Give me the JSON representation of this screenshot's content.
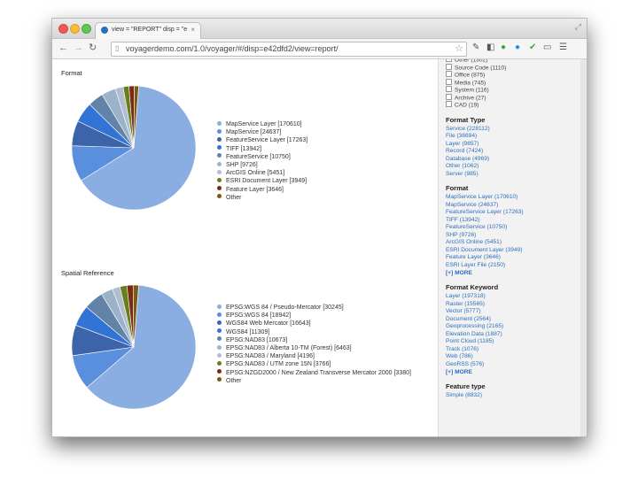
{
  "window": {
    "tab_title": "view = \"REPORT\" disp = \"e",
    "tab_close": "×",
    "url": "voyagerdemo.com/1.0/voyager/#/disp=e42dfd2/view=report/"
  },
  "icons": {
    "back": "back-arrow-icon",
    "forward": "forward-arrow-icon",
    "reload": "reload-icon",
    "star": "bookmark-star-icon"
  },
  "colors": {
    "slices": [
      "#8aaee2",
      "#5a8fdd",
      "#3d64a8",
      "#3273d6",
      "#6382a8",
      "#9cb2c9",
      "#b0bfcf",
      "#6b7e1e",
      "#7a2b12",
      "#7a5a14"
    ],
    "link": "#2a6fbf"
  },
  "format_section": {
    "title": "Format",
    "legend": [
      "MapService Layer [170610]",
      "MapService [24637]",
      "FeatureService Layer [17263]",
      "TIFF [13942]",
      "FeatureService [10750]",
      "SHP [9726]",
      "ArcGIS Online [5451]",
      "ESRI Document Layer [3949]",
      "Feature Layer [3646]",
      "Other"
    ],
    "values": [
      170610,
      24637,
      17263,
      13942,
      10750,
      9726,
      5451,
      3949,
      3646,
      3000
    ]
  },
  "spatial_section": {
    "title": "Spatial Reference",
    "legend": [
      "EPSG:WGS 84 / Pseudo-Mercator [30245]",
      "EPSG:WGS 84 [18942]",
      "WGS84 Web Mercator [16643]",
      "WGS84 [11309]",
      "EPSG:NAD83 [10673]",
      "EPSG:NAD83 / Alberta 10-TM (Forest) [6463]",
      "EPSG:NAD83 / Maryland [4196]",
      "EPSG:NAD83 / UTM zone 15N [3766]",
      "EPSG:NZGD2000 / New Zealand Transverse Mercator 2000 [3380]",
      "Other"
    ],
    "values": [
      130000,
      18942,
      16643,
      11309,
      10673,
      6463,
      4196,
      3766,
      3380,
      3000
    ]
  },
  "sidebar": {
    "top_items": [
      "Other (1302)",
      "Source Code (1110)",
      "Office (875)",
      "Media (745)",
      "System (116)",
      "Archive (27)",
      "CAD (19)"
    ],
    "format_type": {
      "title": "Format Type",
      "items": [
        "Service (228112)",
        "File (36694)",
        "Layer (9857)",
        "Record (7424)",
        "Database (4969)",
        "Other (1062)",
        "Server (985)"
      ]
    },
    "format": {
      "title": "Format",
      "items": [
        "MapService Layer (170610)",
        "MapService (24637)",
        "FeatureService Layer (17263)",
        "TIFF (13942)",
        "FeatureService (10750)",
        "SHP (9726)",
        "ArcGIS Online (5451)",
        "ESRI Document Layer (3949)",
        "Feature Layer (3646)",
        "ESRI Layer File (2150)"
      ],
      "more": "[+] MORE"
    },
    "format_keyword": {
      "title": "Format Keyword",
      "items": [
        "Layer (197318)",
        "Raster (15565)",
        "Vector (5777)",
        "Document (2564)",
        "Geoprocessing (2165)",
        "Elevation Data (1887)",
        "Point Cloud (1185)",
        "Track (1076)",
        "Web (786)",
        "GeoRSS (576)"
      ],
      "more": "[+] MORE"
    },
    "feature_type": {
      "title": "Feature type",
      "items": [
        "Simple (8832)"
      ]
    }
  }
}
